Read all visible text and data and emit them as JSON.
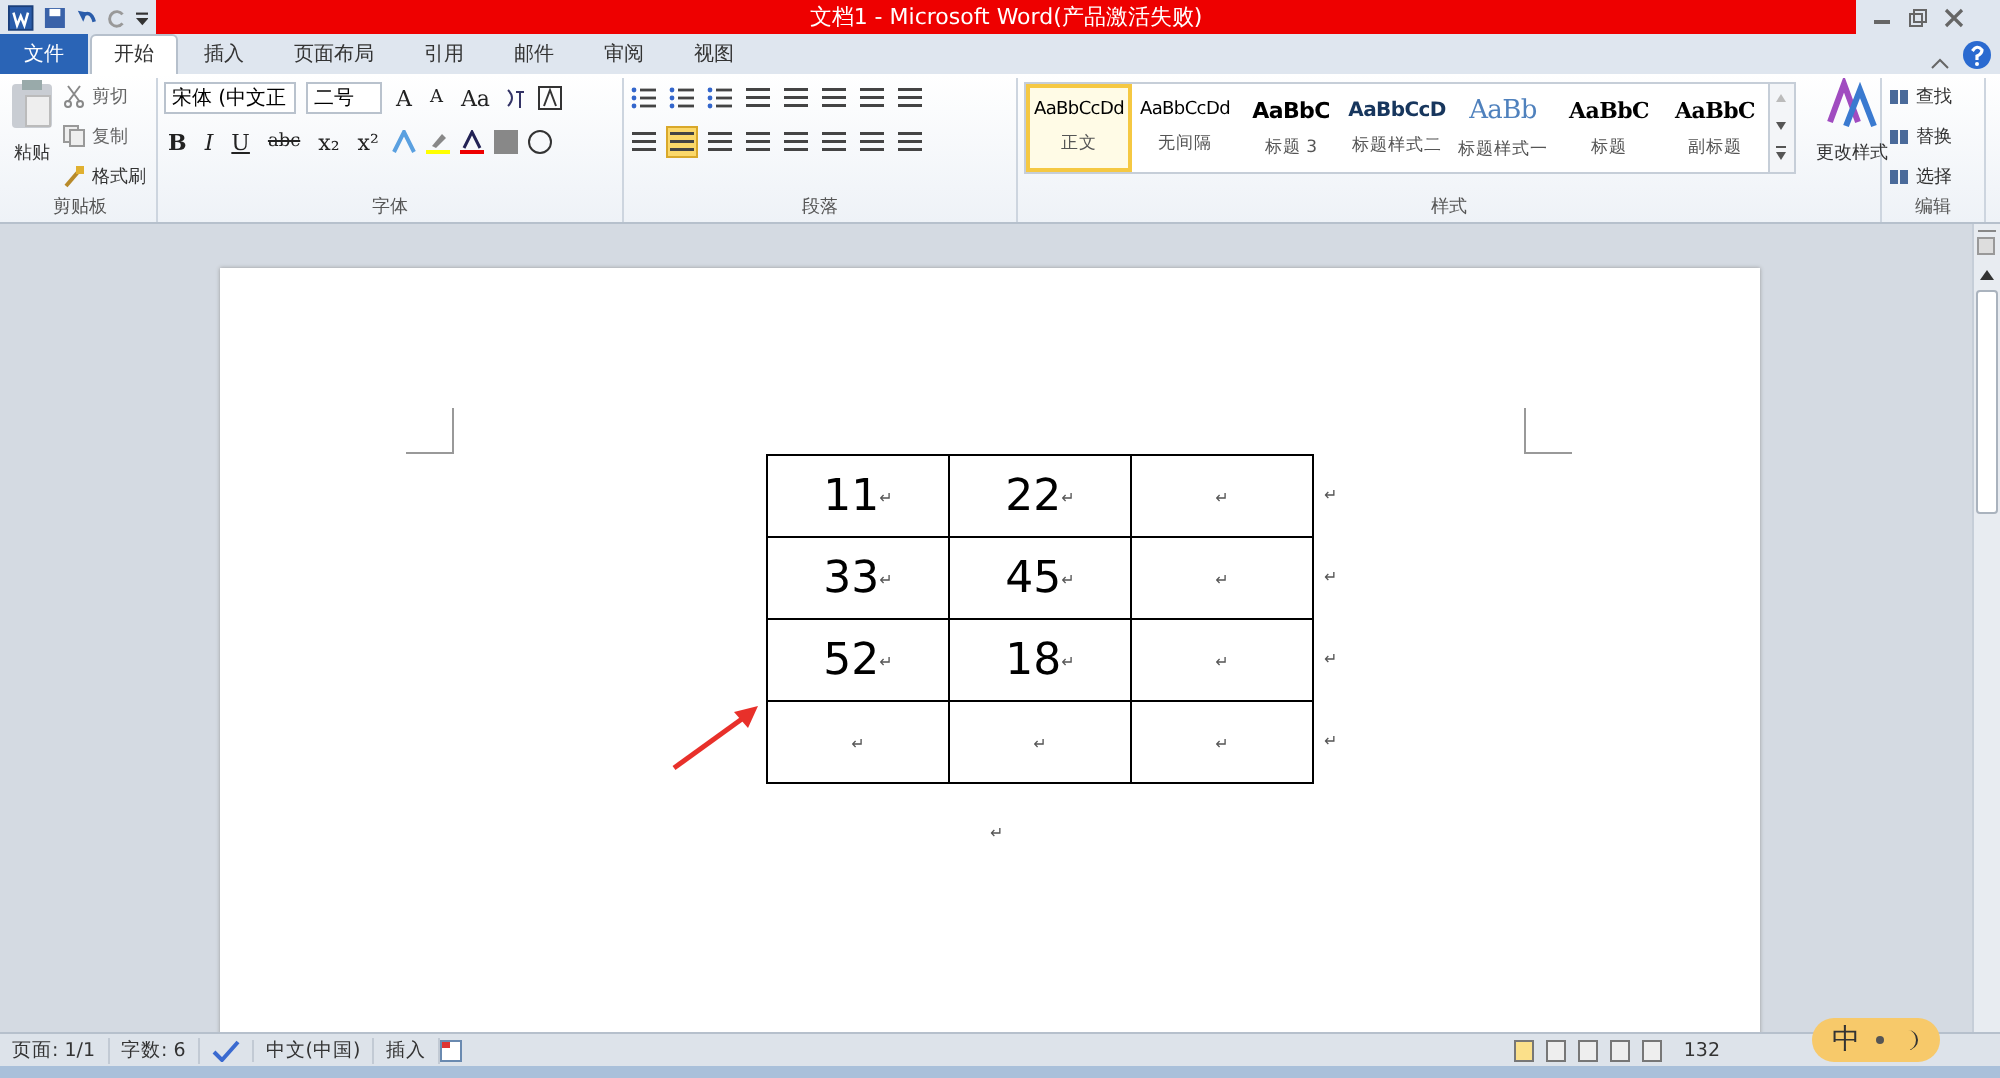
{
  "window": {
    "title": "文档1 - Microsoft Word(产品激活失败)"
  },
  "tabs": [
    {
      "label": "文件",
      "kind": "file",
      "selected": false
    },
    {
      "label": "开始",
      "kind": "tab",
      "selected": true
    },
    {
      "label": "插入",
      "kind": "tab",
      "selected": false
    },
    {
      "label": "页面布局",
      "kind": "tab",
      "selected": false
    },
    {
      "label": "引用",
      "kind": "tab",
      "selected": false
    },
    {
      "label": "邮件",
      "kind": "tab",
      "selected": false
    },
    {
      "label": "审阅",
      "kind": "tab",
      "selected": false
    },
    {
      "label": "视图",
      "kind": "tab",
      "selected": false
    }
  ],
  "ribbon": {
    "clipboard": {
      "paste": "粘贴",
      "cut": "剪切",
      "copy": "复制",
      "format_painter": "格式刷",
      "label": "剪贴板"
    },
    "font": {
      "font_name": "宋体 (中文正",
      "font_size": "二号",
      "row1_buttons": [
        "A",
        "A",
        "Aa"
      ],
      "row2_buttons": [
        "B",
        "I",
        "U",
        "abc",
        "x₂",
        "x²"
      ],
      "label": "字体"
    },
    "paragraph": {
      "label": "段落"
    },
    "styles": {
      "items": [
        {
          "preview": "AaBbCcDd",
          "name": "正文",
          "selected": true
        },
        {
          "preview": "AaBbCcDd",
          "name": "无间隔",
          "selected": false
        },
        {
          "preview": "AaBbC",
          "name": "标题 3",
          "selected": false
        },
        {
          "preview": "AaBbCcD",
          "name": "标题样式二",
          "selected": false
        },
        {
          "preview": "AaBb",
          "name": "标题样式一",
          "selected": false
        },
        {
          "preview": "AaBbC",
          "name": "标题",
          "selected": false
        },
        {
          "preview": "AaBbC",
          "name": "副标题",
          "selected": false
        }
      ],
      "change_styles": "更改样式",
      "label": "样式"
    },
    "editing": {
      "find": "查找",
      "replace": "替换",
      "select": "选择",
      "label": "编辑"
    }
  },
  "document": {
    "paragraph_mark": "↵",
    "table": {
      "rows": [
        [
          "11",
          "22",
          ""
        ],
        [
          "33",
          "45",
          ""
        ],
        [
          "52",
          "18",
          ""
        ],
        [
          "",
          "",
          ""
        ]
      ]
    }
  },
  "status_bar": {
    "page": "页面: 1/1",
    "words": "字数: 6",
    "language": "中文(中国)",
    "mode": "插入",
    "zoom": "132"
  },
  "ime": {
    "label": "中"
  }
}
